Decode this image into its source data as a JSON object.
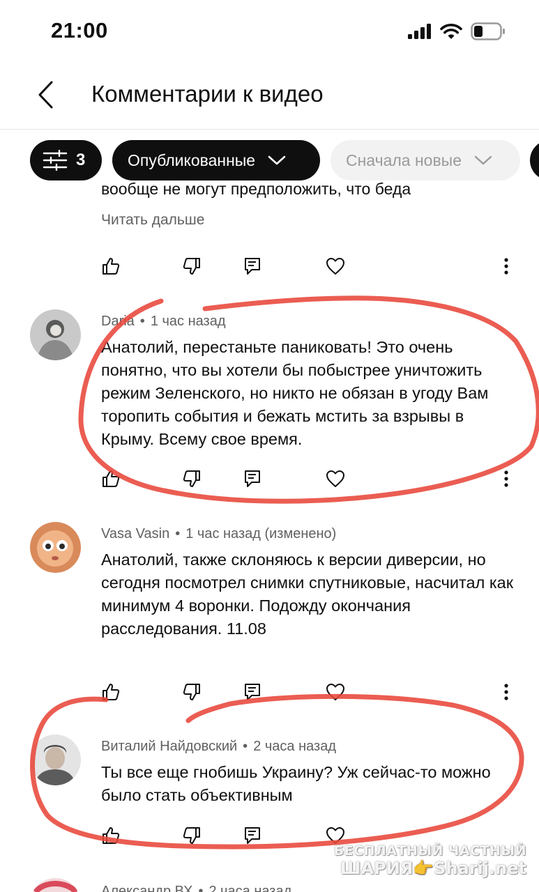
{
  "status": {
    "time": "21:00"
  },
  "header": {
    "title": "Комментарии к видео"
  },
  "chips": {
    "filter_count": "3",
    "status_label": "Опубликованные",
    "sort_label": "Сначала новые"
  },
  "partial_comment": {
    "clipped_text": "вообще не могут предположить, что беда",
    "read_more": "Читать дальше"
  },
  "comments": [
    {
      "author": "Daria",
      "time": "1 час назад",
      "edited": "",
      "text": "Анатолий, перестаньте паниковать! Это очень понятно, что вы хотели бы побыстрее уничтожить режим Зеленского, но никто не обязан в угоду Вам торопить события и бежать мстить за взрывы в Крыму. Всему свое время."
    },
    {
      "author": "Vasa Vasin",
      "time": "1 час назад",
      "edited": "(изменено)",
      "text": "Анатолий, также склоняюсь к версии диверсии, но сегодня посмотрел снимки спутниковые, насчитал как минимум 4 воронки. Подожду окончания расследования. 11.08"
    },
    {
      "author": "Виталий Найдовский",
      "time": "2 часа назад",
      "edited": "",
      "text": "Ты все еще гнобишь Украину? Уж сейчас-то можно было стать объективным"
    },
    {
      "author": "Александр ВХ",
      "time": "2 часа назад",
      "edited": "",
      "text": ""
    }
  ],
  "watermark": {
    "line1": "БЕСПЛАТНЫЙ ЧАСТНЫЙ",
    "line2": "ШАРИЯ👉Sharij.net"
  },
  "colors": {
    "annotation": "#e8473a",
    "chip_dark": "#0f0f0f",
    "chip_light": "#f2f2f2",
    "meta_text": "#606060"
  },
  "icons": [
    "back-arrow-icon",
    "signal-icon",
    "wifi-icon",
    "battery-icon",
    "filter-sliders-icon",
    "chevron-down-icon",
    "thumbs-up-icon",
    "thumbs-down-icon",
    "reply-icon",
    "heart-icon",
    "more-vertical-icon"
  ]
}
